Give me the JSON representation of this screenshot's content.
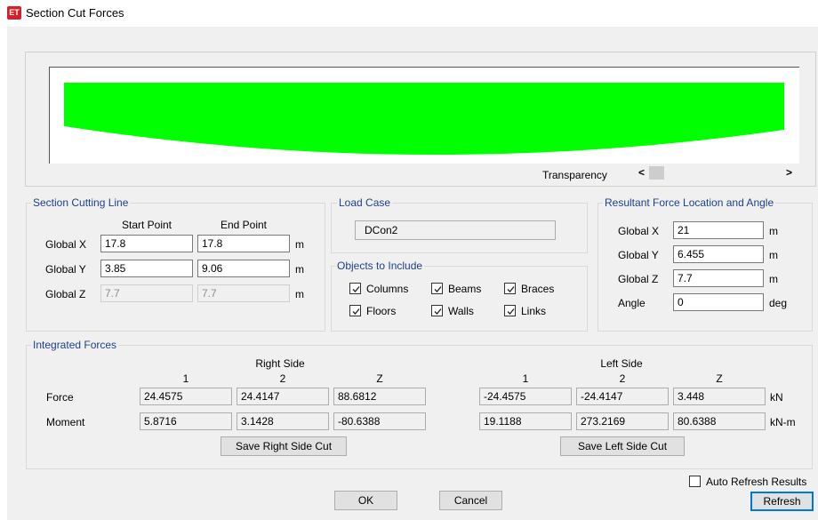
{
  "window": {
    "title": "Section Cut Forces",
    "icon_text": "ET"
  },
  "preview": {
    "fill_color": "#00ff00",
    "transparency_label": "Transparency",
    "scroll_left": "<",
    "scroll_right": ">"
  },
  "cutting_line": {
    "title": "Section Cutting Line",
    "start_header": "Start Point",
    "end_header": "End Point",
    "rows": [
      {
        "label": "Global  X",
        "start": "17.8",
        "end": "17.8",
        "unit": "m"
      },
      {
        "label": "Global  Y",
        "start": "3.85",
        "end": "9.06",
        "unit": "m"
      },
      {
        "label": "Global  Z",
        "start": "7.7",
        "end": "7.7",
        "unit": "m"
      }
    ]
  },
  "load_case": {
    "title": "Load Case",
    "value": "DCon2"
  },
  "objects": {
    "title": "Objects to Include",
    "items": [
      {
        "label": "Columns",
        "checked": true
      },
      {
        "label": "Beams",
        "checked": true
      },
      {
        "label": "Braces",
        "checked": true
      },
      {
        "label": "Floors",
        "checked": true
      },
      {
        "label": "Walls",
        "checked": true
      },
      {
        "label": "Links",
        "checked": true
      }
    ]
  },
  "resultant": {
    "title": "Resultant Force Location and Angle",
    "rows": [
      {
        "label": "Global  X",
        "value": "21",
        "unit": "m"
      },
      {
        "label": "Global  Y",
        "value": "6.455",
        "unit": "m"
      },
      {
        "label": "Global  Z",
        "value": "7.7",
        "unit": "m"
      },
      {
        "label": "Angle",
        "value": "0",
        "unit": "deg"
      }
    ]
  },
  "integrated": {
    "title": "Integrated Forces",
    "right_side_label": "Right Side",
    "left_side_label": "Left Side",
    "col_headers": [
      "1",
      "2",
      "Z"
    ],
    "rows": [
      {
        "label": "Force",
        "right": [
          "24.4575",
          "24.4147",
          "88.6812"
        ],
        "left": [
          "-24.4575",
          "-24.4147",
          "3.448"
        ],
        "unit": "kN"
      },
      {
        "label": "Moment",
        "right": [
          "5.8716",
          "3.1428",
          "-80.6388"
        ],
        "left": [
          "19.1188",
          "273.2169",
          "80.6388"
        ],
        "unit": "kN-m"
      }
    ],
    "save_right_label": "Save Right Side Cut",
    "save_left_label": "Save Left Side Cut"
  },
  "footer": {
    "auto_refresh_label": "Auto Refresh Results",
    "auto_refresh_checked": false,
    "ok_label": "OK",
    "cancel_label": "Cancel",
    "refresh_label": "Refresh"
  }
}
